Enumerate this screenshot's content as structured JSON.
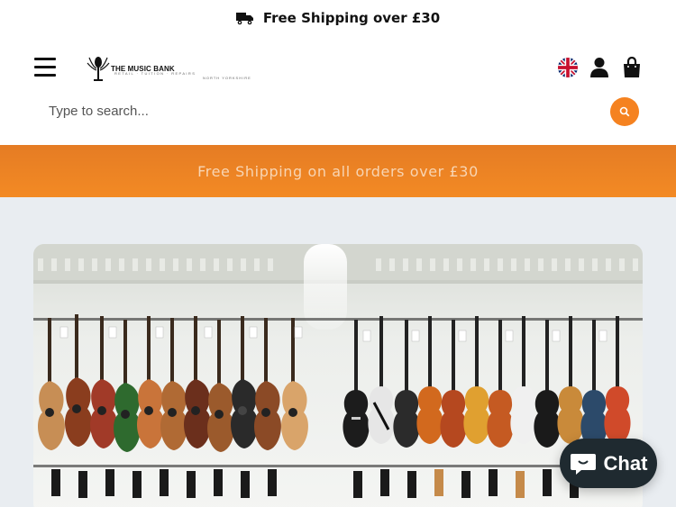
{
  "announcement": {
    "icon": "truck-icon",
    "text": "Free Shipping over £30"
  },
  "header": {
    "logo": {
      "name": "THE MUSIC BANK",
      "tagline": "RETAIL · TUITION · REPAIRS",
      "location": "NORTH YORKSHIRE"
    },
    "icons": {
      "menu": "menu-icon",
      "flag": "uk-flag-icon",
      "account": "account-icon",
      "cart": "cart-icon"
    },
    "search": {
      "placeholder": "Type to search..."
    }
  },
  "promo": {
    "text": "Free Shipping on all orders over £30"
  },
  "chat": {
    "label": "Chat"
  },
  "colors": {
    "accent": "#f58220",
    "promo_bg": "#ee8424",
    "chat_bg": "#1f2a30",
    "page_bg": "#e9edf1"
  }
}
